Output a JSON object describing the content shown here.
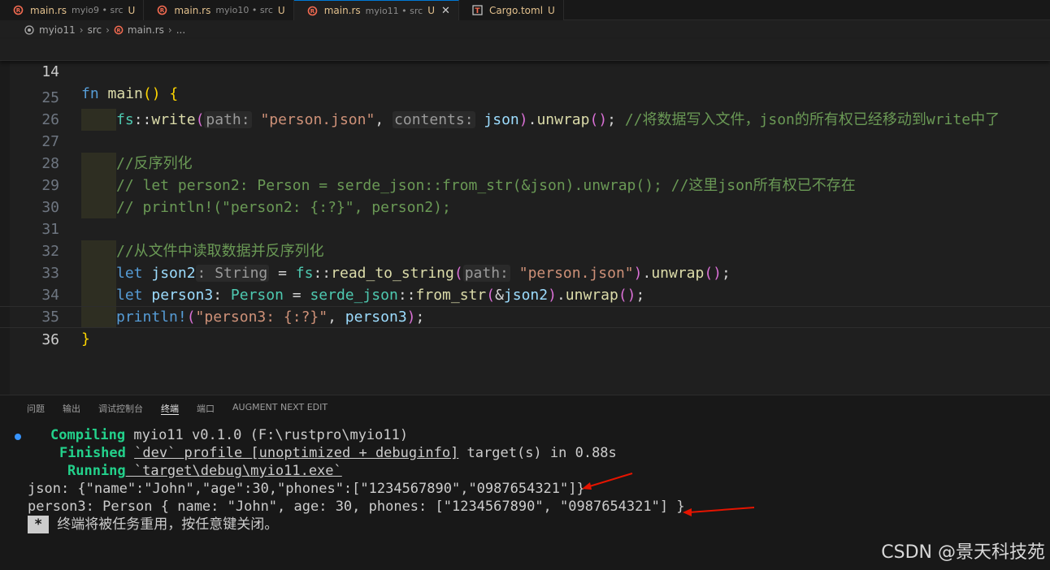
{
  "tabs": [
    {
      "name": "main.rs",
      "desc": "myio9 • src",
      "status": "U",
      "active": false
    },
    {
      "name": "main.rs",
      "desc": "myio10 • src",
      "status": "U",
      "active": false
    },
    {
      "name": "main.rs",
      "desc": "myio11 • src",
      "status": "U",
      "active": true,
      "close": "✕"
    },
    {
      "name": "Cargo.toml",
      "desc": "",
      "status": "U",
      "active": false
    }
  ],
  "breadcrumb": [
    "myio11",
    "src",
    "main.rs",
    "..."
  ],
  "editor": {
    "line_numbers": [
      "14",
      "25",
      "26",
      "27",
      "28",
      "29",
      "30",
      "31",
      "32",
      "33",
      "34",
      "35",
      "36"
    ],
    "sticky_fn": "fn",
    "sticky_main": "main",
    "write_comment": "//将数据写入文件，json的所有权已经移动到write中了",
    "comment_deserialize": "//反序列化",
    "comment_let_person2": "// let person2: Person = serde_json::from_str(&json).unwrap(); //这里json所有权已不存在",
    "comment_println_person2": "// println!(\"person2: {:?}\", person2);",
    "comment_read_file": "//从文件中读取数据并反序列化",
    "hint_path": "path:",
    "hint_contents": "contents:",
    "hint_string": ": String",
    "str_person_json": "\"person.json\"",
    "str_format": "\"person3: {:?}\"",
    "id_json": "json",
    "id_json2": "json2",
    "id_person3": "person3",
    "ty_person": "Person",
    "fn_write": "write",
    "fn_unwrap": "unwrap",
    "fn_read_to_string": "read_to_string",
    "fn_from_str": "from_str",
    "ns_fs": "fs",
    "ns_serde_json": "serde_json",
    "kw_let": "let",
    "mac_println": "println!"
  },
  "panel": {
    "tabs": [
      "问题",
      "输出",
      "调试控制台",
      "终端",
      "端口",
      "AUGMENT NEXT EDIT"
    ],
    "active_tab": "终端"
  },
  "terminal": {
    "compiling_label": "Compiling",
    "compiling_text": " myio11 v0.1.0 (F:\\rustpro\\myio11)",
    "finished_label": "Finished",
    "finished_profile": "`dev` profile [unoptimized + debuginfo]",
    "finished_rest": " target(s) in 0.88s",
    "running_label": "Running",
    "running_text": " `target\\debug\\myio11.exe`",
    "json_line": "json: {\"name\":\"John\",\"age\":30,\"phones\":[\"1234567890\",\"0987654321\"]}",
    "person3_line": "person3: Person { name: \"John\", age: 30, phones: [\"1234567890\", \"0987654321\"] }",
    "star": "*",
    "reuse_msg": "终端将被任务重用，按任意键关闭。"
  },
  "watermark": "CSDN @景天科技苑",
  "colors": {
    "accent": "#0078d4",
    "green": "#23d18b",
    "arrow": "#e51400",
    "modified": "#e2c08d"
  }
}
